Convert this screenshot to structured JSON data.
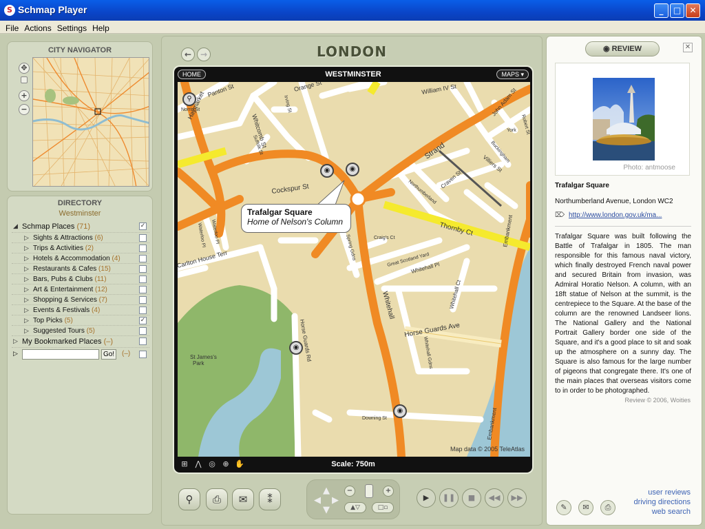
{
  "window": {
    "title": "Schmap Player",
    "min_glyph": "_",
    "max_glyph": "□",
    "close_glyph": "✕"
  },
  "menu": [
    "File",
    "Actions",
    "Settings",
    "Help"
  ],
  "navigator": {
    "title": "CITY NAVIGATOR"
  },
  "directory": {
    "title": "DIRECTORY",
    "subtitle": "Westminster",
    "items": [
      {
        "label": "Schmap Places",
        "count": "(71)",
        "checked": true,
        "level": 0,
        "expanded": true
      },
      {
        "label": "Sights & Attractions",
        "count": "(6)",
        "checked": false,
        "level": 1
      },
      {
        "label": "Trips & Activities",
        "count": "(2)",
        "checked": false,
        "level": 1
      },
      {
        "label": "Hotels & Accommodation",
        "count": "(4)",
        "checked": false,
        "level": 1
      },
      {
        "label": "Restaurants & Cafes",
        "count": "(15)",
        "checked": false,
        "level": 1
      },
      {
        "label": "Bars, Pubs & Clubs",
        "count": "(11)",
        "checked": false,
        "level": 1
      },
      {
        "label": "Art & Entertainment",
        "count": "(12)",
        "checked": false,
        "level": 1
      },
      {
        "label": "Shopping & Services",
        "count": "(7)",
        "checked": false,
        "level": 1
      },
      {
        "label": "Events & Festivals",
        "count": "(4)",
        "checked": false,
        "level": 1
      },
      {
        "label": "Top Picks",
        "count": "(5)",
        "checked": true,
        "level": 1
      },
      {
        "label": "Suggested Tours",
        "count": "(5)",
        "checked": false,
        "level": 1
      },
      {
        "label": "My Bookmarked Places",
        "count": "(–)",
        "checked": false,
        "level": 0
      }
    ],
    "search": {
      "value": "",
      "go_label": "Go!",
      "count": "(–)"
    }
  },
  "center": {
    "city": "LONDON",
    "area": "WESTMINSTER",
    "home_label": "HOME",
    "maps_label": "MAPS ▾",
    "scale": "Scale: 750m",
    "copyright": "Map data © 2005 TeleAtlas",
    "callout": {
      "name": "Trafalgar Square",
      "desc": "Home of Nelson's Column"
    },
    "streets": {
      "haymarket": "Haymarket",
      "panton": "Panton St",
      "orange": "Orange St",
      "william": "William IV St",
      "whitcomb": "Whitcomb St",
      "irving": "Irving St",
      "strand": "Strand",
      "john_adam": "John Adam St",
      "york": "York",
      "buckingham": "Buckingham",
      "villiers": "Villiers St",
      "robert": "Robert St",
      "cockspur": "Cockspur St",
      "northumberland": "Northumberland",
      "craven": "Craven St",
      "thornby": "Thornby Ct",
      "embankment": "Embankment",
      "waterloo1": "Waterloo Pl",
      "waterloo2": "Waterloo Pl",
      "suffolk": "Suffolk St",
      "spring": "Spring Gdns",
      "craigs": "Craig's Ct",
      "gt_scotland": "Great Scotland Yard",
      "whitehall_pl": "Whitehall Pl",
      "whitehall_ct": "Whitehall Ct",
      "carlton": "Carlton House Terr",
      "whitehall": "Whitehall",
      "horse_guards_ave": "Horse Guards Ave",
      "whitehall_gdns": "Whitehall Gdns",
      "horse_guards_rd": "Horse Guards Rd",
      "st_james1": "St James's",
      "st_james2": "Park",
      "downing": "Downing St",
      "embankment2": "Embankment",
      "norris": "Norris St"
    }
  },
  "review": {
    "button_label": "REVIEW",
    "close_label": "✕",
    "photo_credit": "Photo: antmoose",
    "place_name": "Trafalgar Square",
    "address": "Northumberland Avenue, London WC2",
    "url": "http://www.london.gov.uk/ma...",
    "text": "Trafalgar Square was built following the Battle of Trafalgar in 1805. The man responsible for this famous naval victory, which finally destroyed French naval power and secured Britain from invasion, was Admiral Horatio Nelson. A column, with an 18ft statue of Nelson at the summit, is the centrepiece to the Square. At the base of the column are the renowned Landseer lions. The National Gallery and the National Portrait Gallery border one side of the Square, and it's a good place to sit and soak up the atmosphere on a sunny day. The Square is also famous for the large number of pigeons that congregate there. It's one of the main places that overseas visitors come to in order to be photographed.",
    "credit": "Review © 2006, Woities",
    "links": [
      "user reviews",
      "driving directions",
      "web search"
    ]
  }
}
